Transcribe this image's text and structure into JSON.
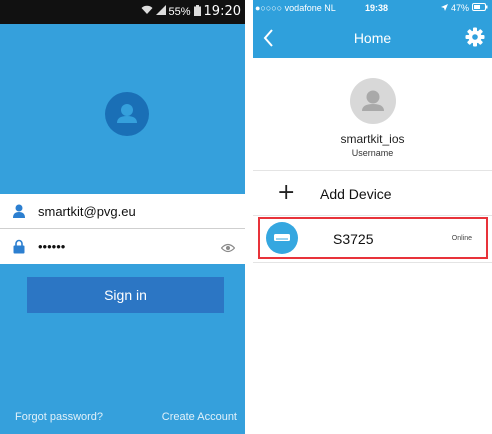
{
  "left_screen": {
    "status_bar": {
      "battery_percent": "55%",
      "time": "19:20"
    },
    "email_value": "smartkit@pvg.eu",
    "password_value": "••••••",
    "sign_in_label": "Sign in",
    "forgot_password_label": "Forgot password?",
    "create_account_label": "Create Account",
    "icons": [
      "wifi-icon",
      "signal-icon",
      "battery-icon",
      "avatar-icon",
      "user-icon",
      "lock-icon",
      "eye-icon"
    ]
  },
  "right_screen": {
    "status_bar": {
      "carrier": "●○○○○ vodafone NL",
      "time": "19:38",
      "battery_percent": "47%"
    },
    "nav": {
      "title": "Home"
    },
    "profile": {
      "username": "smartkit_ios",
      "username_label": "Username"
    },
    "add_device_label": "Add Device",
    "devices": [
      {
        "name": "S3725",
        "status": "Online"
      }
    ],
    "icons": [
      "back-chevron-icon",
      "gear-icon",
      "avatar-icon",
      "plus-icon",
      "air-conditioner-icon"
    ]
  },
  "colors": {
    "primary_blue": "#35a0dc",
    "button_blue": "#2c76c4",
    "header_blue": "#2fa0dc",
    "highlight_red": "#e8333a"
  }
}
